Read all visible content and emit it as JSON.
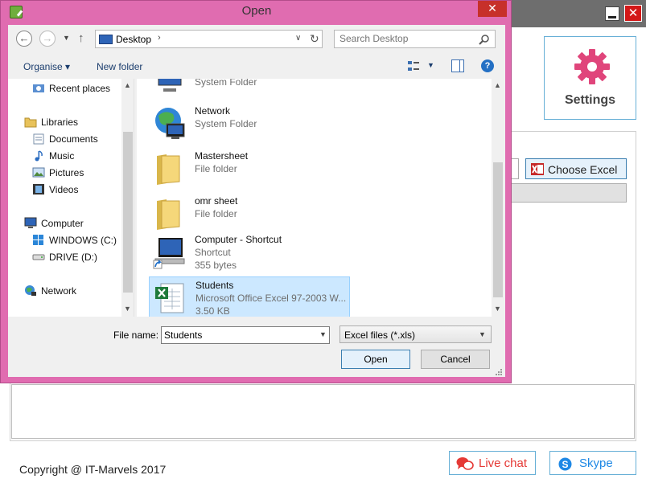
{
  "app": {
    "settings_label": "Settings",
    "choose_excel_label": "Choose Excel",
    "generate_label_fragment": "il",
    "copyright": "Copyright @ IT-Marvels 2017",
    "live_chat_label": "Live chat",
    "skype_label": "Skype",
    "close_glyph": "✕",
    "accent_pink": "#e0457b",
    "accent_blue": "#66afd6"
  },
  "dialog": {
    "title": "Open",
    "close_glyph": "✕",
    "address": {
      "location": "Desktop",
      "separator": "›",
      "search_placeholder": "Search Desktop"
    },
    "toolbar": {
      "organise_label": "Organise ▾",
      "new_folder_label": "New folder",
      "help_glyph": "?"
    },
    "nav": {
      "items": [
        {
          "label": "Recent places",
          "icon": "recent-places-icon"
        },
        {
          "label": "Libraries",
          "icon": "libraries-icon"
        },
        {
          "label": "Documents",
          "icon": "documents-icon"
        },
        {
          "label": "Music",
          "icon": "music-icon"
        },
        {
          "label": "Pictures",
          "icon": "pictures-icon"
        },
        {
          "label": "Videos",
          "icon": "videos-icon"
        },
        {
          "label": "Computer",
          "icon": "computer-icon"
        },
        {
          "label": "WINDOWS (C:)",
          "icon": "drive-c-icon"
        },
        {
          "label": "DRIVE (D:)",
          "icon": "drive-d-icon"
        },
        {
          "label": "Network",
          "icon": "network-icon"
        }
      ]
    },
    "files": [
      {
        "name": "",
        "type": "System Folder",
        "size": "",
        "icon": "computer-icon"
      },
      {
        "name": "Network",
        "type": "System Folder",
        "size": "",
        "icon": "network-globe-icon"
      },
      {
        "name": "Mastersheet",
        "type": "File folder",
        "size": "",
        "icon": "folder-icon"
      },
      {
        "name": "omr sheet",
        "type": "File folder",
        "size": "",
        "icon": "folder-icon"
      },
      {
        "name": "Computer - Shortcut",
        "type": "Shortcut",
        "size": "355 bytes",
        "icon": "computer-shortcut-icon"
      },
      {
        "name": "Students",
        "type": "Microsoft Office Excel 97-2003 W...",
        "size": "3.50 KB",
        "icon": "excel-file-icon",
        "selected": true
      }
    ],
    "file_name_label": "File name:",
    "file_name_value": "Students",
    "filter_value": "Excel files (*.xls)",
    "open_label": "Open",
    "cancel_label": "Cancel"
  }
}
